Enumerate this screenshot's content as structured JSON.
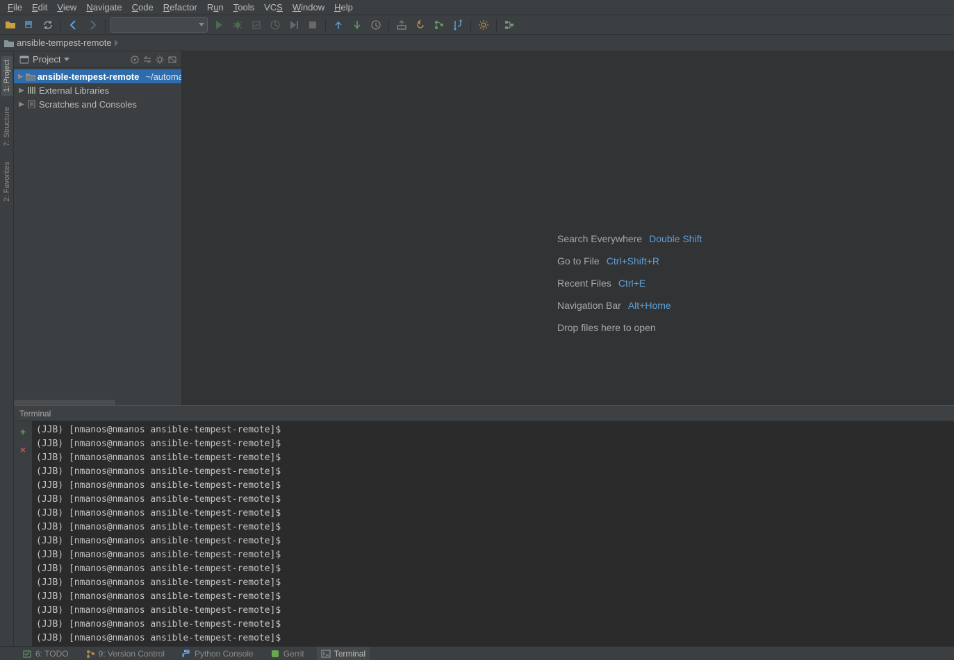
{
  "menu": {
    "items": [
      {
        "label": "File",
        "mn": 0
      },
      {
        "label": "Edit",
        "mn": 0
      },
      {
        "label": "View",
        "mn": 0
      },
      {
        "label": "Navigate",
        "mn": 0
      },
      {
        "label": "Code",
        "mn": 0
      },
      {
        "label": "Refactor",
        "mn": 0
      },
      {
        "label": "Run",
        "mn": 1
      },
      {
        "label": "Tools",
        "mn": 0
      },
      {
        "label": "VCS",
        "mn": 2
      },
      {
        "label": "Window",
        "mn": 0
      },
      {
        "label": "Help",
        "mn": 0
      }
    ]
  },
  "toolbar": {
    "icons": [
      "folder-open-icon",
      "save-all-icon",
      "sync-icon",
      "sep",
      "back-icon",
      "forward-icon",
      "sep",
      "runconfig",
      "run-icon",
      "debug-icon",
      "coverage-icon",
      "profile-icon",
      "run-current-icon",
      "stop-icon",
      "sep",
      "vcs-update-icon",
      "vcs-commit-icon",
      "vcs-history-icon",
      "sep",
      "push-icon",
      "rollback-icon",
      "branch-icon",
      "merge-icon",
      "sep",
      "settings-icon",
      "sep",
      "structure-icon"
    ]
  },
  "breadcrumb": {
    "items": [
      {
        "icon": "folder-icon",
        "label": "ansible-tempest-remote"
      }
    ]
  },
  "left_gutter": {
    "tabs": [
      {
        "label": "1: Project",
        "selected": true
      },
      {
        "label": "7: Structure",
        "selected": false
      },
      {
        "label": "2: Favorites",
        "selected": false
      }
    ]
  },
  "project": {
    "title": "Project",
    "header_buttons": [
      "locate-icon",
      "scroll-icon",
      "settings-icon",
      "hide-icon"
    ],
    "tree": [
      {
        "arrow": "right",
        "icon": "project-folder-icon",
        "label": "ansible-tempest-remote",
        "hint": "~/automation",
        "selected": true,
        "bold": true
      },
      {
        "arrow": "right",
        "icon": "libraries-icon",
        "label": "External Libraries"
      },
      {
        "arrow": "right",
        "icon": "scratches-icon",
        "label": "Scratches and Consoles"
      }
    ]
  },
  "editor_tips": [
    {
      "text": "Search Everywhere",
      "shortcut": "Double Shift"
    },
    {
      "text": "Go to File",
      "shortcut": "Ctrl+Shift+R"
    },
    {
      "text": "Recent Files",
      "shortcut": "Ctrl+E"
    },
    {
      "text": "Navigation Bar",
      "shortcut": "Alt+Home"
    },
    {
      "text": "Drop files here to open",
      "shortcut": ""
    }
  ],
  "terminal": {
    "title": "Terminal",
    "tabs": {
      "add": "+",
      "close": "×"
    },
    "prompt": "(JJB) [nmanos@nmanos ansible-tempest-remote]$",
    "line_count": 16
  },
  "bottom_tabs": [
    {
      "icon": "todo-icon",
      "label": "6: TODO",
      "color": "#6ba36b"
    },
    {
      "icon": "vc-icon",
      "label": "9: Version Control",
      "color": "#b58a4a"
    },
    {
      "icon": "python-icon",
      "label": "Python Console",
      "color": "#5a90c9"
    },
    {
      "icon": "gerrit-icon",
      "label": "Gerrit",
      "color": "#6aa84f"
    },
    {
      "icon": "terminal-icon",
      "label": "Terminal",
      "color": "#a0a0a0",
      "active": true
    }
  ]
}
